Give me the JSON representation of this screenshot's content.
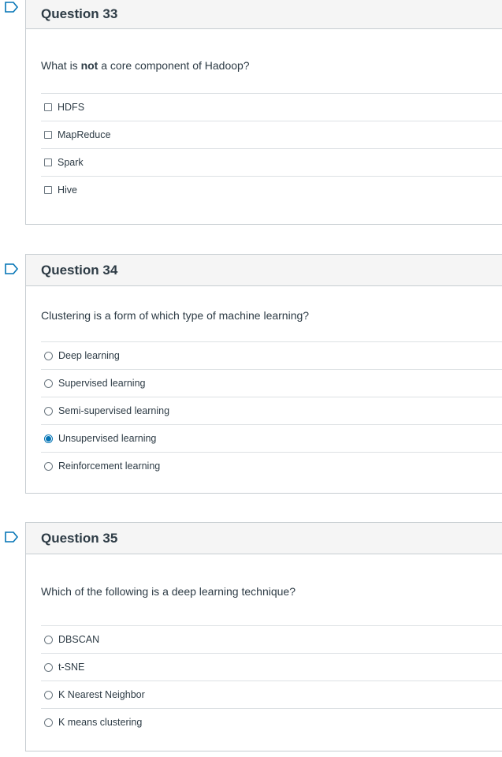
{
  "questions": [
    {
      "title": "Question 33",
      "text_before": "What is ",
      "text_bold": "not",
      "text_after": " a core component of Hadoop?",
      "input_type": "checkbox",
      "answers": [
        {
          "label": "HDFS",
          "selected": false
        },
        {
          "label": "MapReduce",
          "selected": false
        },
        {
          "label": "Spark",
          "selected": false
        },
        {
          "label": "Hive",
          "selected": false
        }
      ]
    },
    {
      "title": "Question 34",
      "text": "Clustering is a form of which type of machine learning?",
      "input_type": "radio",
      "answers": [
        {
          "label": "Deep learning",
          "selected": false
        },
        {
          "label": "Supervised learning",
          "selected": false
        },
        {
          "label": "Semi-supervised learning",
          "selected": false
        },
        {
          "label": "Unsupervised learning",
          "selected": true
        },
        {
          "label": "Reinforcement learning",
          "selected": false
        }
      ]
    },
    {
      "title": "Question 35",
      "text": "Which of the following is a deep learning technique?",
      "input_type": "radio",
      "answers": [
        {
          "label": "DBSCAN",
          "selected": false
        },
        {
          "label": "t-SNE",
          "selected": false
        },
        {
          "label": "K Nearest Neighbor",
          "selected": false
        },
        {
          "label": "K means clustering",
          "selected": false
        }
      ]
    }
  ],
  "colors": {
    "accent": "#0374b5",
    "flag": "#0374b5",
    "header_bg": "#f5f5f5",
    "border": "#c7cdd1"
  },
  "icons": {
    "flag": "flag-icon"
  }
}
